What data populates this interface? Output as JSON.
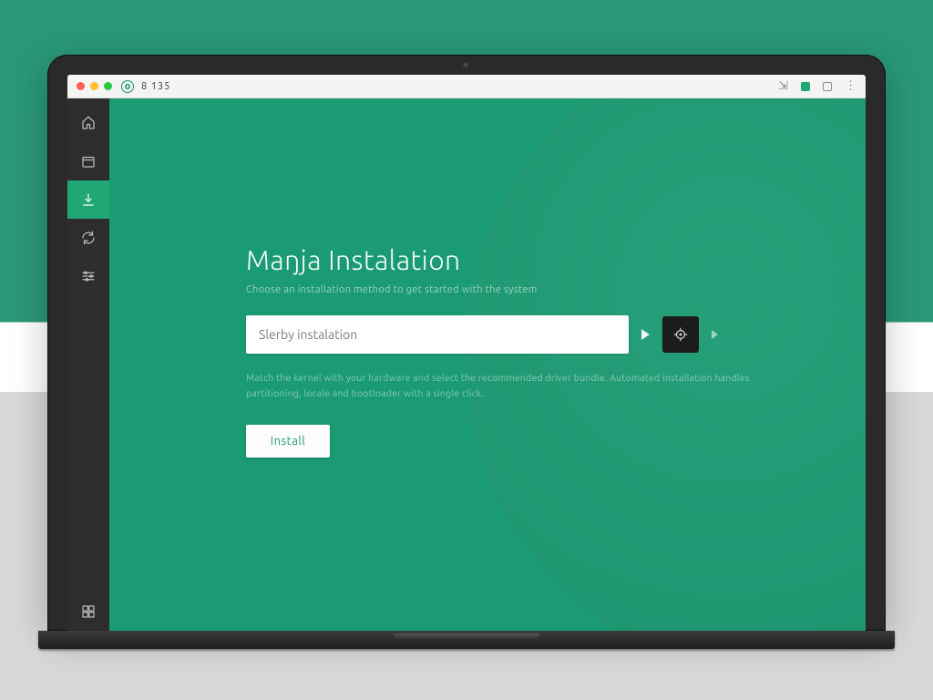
{
  "topbar": {
    "indicator_value": "8 135",
    "right_glyph": "⋮"
  },
  "sidebar": {
    "items": [
      {
        "name": "home",
        "active": false
      },
      {
        "name": "package",
        "active": false
      },
      {
        "name": "install",
        "active": true
      },
      {
        "name": "updates",
        "active": false
      },
      {
        "name": "settings",
        "active": false
      }
    ],
    "footer_item": {
      "name": "misc"
    }
  },
  "main": {
    "title": "Maŋja Instalation",
    "subtitle": "Choose an installation method to get started with the system",
    "search_placeholder": "Slerby instalation",
    "description": "Match the kernel with your hardware and select the recommended driver bundle. Automated installation handles partitioning, locale and bootloader with a single click.",
    "cta_label": "Install"
  }
}
